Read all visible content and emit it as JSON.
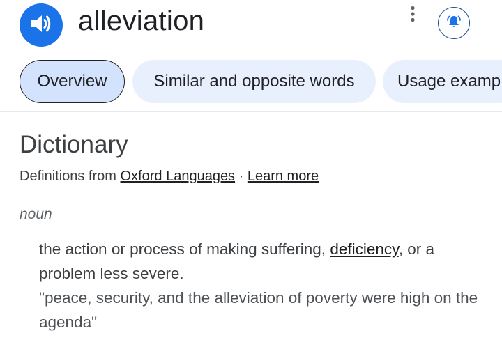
{
  "header": {
    "word": "alleviation",
    "speaker_icon": "speaker-volume-icon",
    "more_icon": "more-vertical-icon",
    "bell_icon": "notification-bell-icon"
  },
  "tabs": [
    {
      "label": "Overview",
      "selected": true
    },
    {
      "label": "Similar and opposite words",
      "selected": false
    },
    {
      "label": "Usage examp",
      "selected": false
    }
  ],
  "dictionary": {
    "title": "Dictionary",
    "source_prefix": "Definitions from ",
    "source_link": "Oxford Languages",
    "separator": " · ",
    "learn_more": "Learn more",
    "part_of_speech": "noun",
    "definition_before": "the action or process of making suffering, ",
    "definition_link": "deficiency",
    "definition_after": ", or a problem less severe.",
    "example": "\"peace, security, and the alleviation of poverty were high on the agenda\""
  },
  "colors": {
    "accent": "#1a73e8",
    "tab_selected": "#d3e3fd",
    "tab_unselected": "#e8f0fe"
  }
}
